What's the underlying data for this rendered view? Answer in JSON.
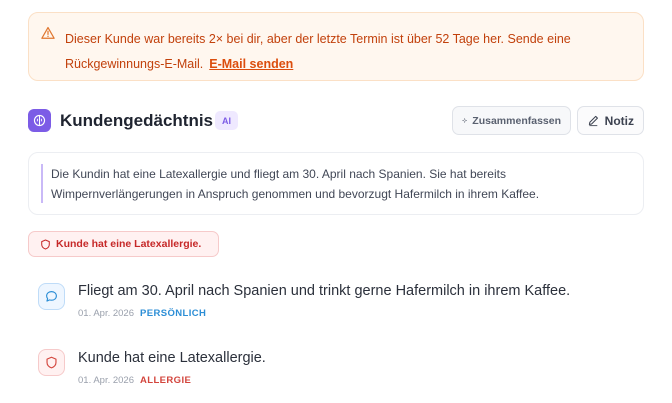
{
  "alert": {
    "message": "Dieser Kunde war bereits 2× bei dir, aber der letzte Termin ist über 52 Tage her. Sende eine Rückgewinnungs-E-Mail.",
    "link_label": "E-Mail senden",
    "icon": "warning-triangle-icon",
    "color": "#c2410c"
  },
  "header": {
    "title": "Kundengedächtnis",
    "badge": "AI",
    "logo_icon": "brain-icon",
    "accent": "#7c5ce6",
    "summarize_label": "Zusammenfassen",
    "note_label": "Notiz"
  },
  "summary": {
    "text": "Die Kundin hat eine Latexallergie und fliegt am 30. April nach Spanien. Sie hat bereits Wimpernverlängerungen in Anspruch genommen und bevorzugt Hafermilch in ihrem Kaffee."
  },
  "allergy_chip": {
    "label": "Kunde hat eine Latexallergie.",
    "icon": "shield-icon"
  },
  "memories": [
    {
      "text": "Fliegt am 30. April nach Spanien und trinkt gerne Hafermilch in ihrem Kaffee.",
      "date": "01. Apr. 2026",
      "tag": "PERSÖNLICH",
      "icon": "chat-bubble-icon",
      "color": "#2c8ed6"
    },
    {
      "text": "Kunde hat eine Latexallergie.",
      "date": "01. Apr. 2026",
      "tag": "ALLERGIE",
      "icon": "shield-icon",
      "color": "#d3453d"
    }
  ]
}
